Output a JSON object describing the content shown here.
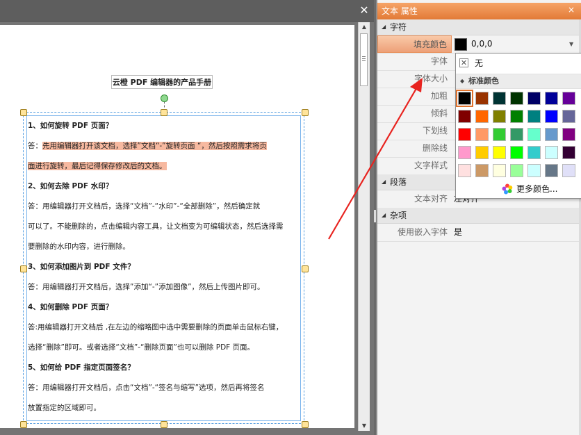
{
  "document": {
    "close_glyph": "✕",
    "title": "云橙 PDF 编辑器的产品手册",
    "lines": [
      {
        "text": "1、如何旋转  PDF  页面？",
        "bold": true,
        "highlight": false
      },
      {
        "text": "答：先用编辑器打开该文档，选择”文档“-”旋转页面 “，然后按照需求将页",
        "bold": false,
        "highlight": true,
        "hl_from": 2
      },
      {
        "text": "面进行旋转，最后记得保存修改后的文档。",
        "bold": false,
        "highlight": true,
        "hl_from": 0
      },
      {
        "text": "2、如何去除  PDF  水印？",
        "bold": true,
        "highlight": false
      },
      {
        "text": "答：用编辑器打开文档后，选择“文档”-“水印”-“全部删除”，然后确定就",
        "bold": false,
        "highlight": false
      },
      {
        "text": "可以了。不能删除的，点击编辑内容工具，让文档变为可编辑状态，然后选择需",
        "bold": false,
        "highlight": false
      },
      {
        "text": "要删除的水印内容，进行删除。",
        "bold": false,
        "highlight": false
      },
      {
        "text": "3、如何添加图片到  PDF  文件？",
        "bold": true,
        "highlight": false
      },
      {
        "text": "答：用编辑器打开文档后，选择”添加“-”添加图像”，然后上传图片即可。",
        "bold": false,
        "highlight": false
      },
      {
        "text": "4、如何删除  PDF  页面？",
        "bold": true,
        "highlight": false
      },
      {
        "text": "答:用编辑器打开文档后 ,在左边的缩略图中选中需要删除的页面单击鼠标右键，",
        "bold": false,
        "highlight": false
      },
      {
        "text": "选择“删除”即可。或者选择“文档”-“删除页面”也可以删除 PDF 页面。",
        "bold": false,
        "highlight": false
      },
      {
        "text": "5、如何给  PDF  指定页面签名？",
        "bold": true,
        "highlight": false
      },
      {
        "text": "答：用编辑器打开文档后，点击“文档”-“签名与缩写”选项，然后再将签名",
        "bold": false,
        "highlight": false
      },
      {
        "text": "放置指定的区域即可。",
        "bold": false,
        "highlight": false
      }
    ]
  },
  "properties_panel": {
    "title": "文本 属性",
    "close_glyph": "×",
    "categories": {
      "character": "字符",
      "paragraph": "段落",
      "misc": "杂项"
    },
    "rows": {
      "fill_color": {
        "name": "填充颜色",
        "value": "0,0,0"
      },
      "font": {
        "name": "字体",
        "value": ""
      },
      "font_size": {
        "name": "字体大小",
        "value": ""
      },
      "bold": {
        "name": "加粗",
        "value": ""
      },
      "italic": {
        "name": "倾斜",
        "value": ""
      },
      "underline": {
        "name": "下划线",
        "value": ""
      },
      "strikethrough": {
        "name": "删除线",
        "value": ""
      },
      "text_style": {
        "name": "文字样式",
        "value": ""
      },
      "text_align": {
        "name": "文本对齐",
        "value": "左对齐"
      },
      "embed_font": {
        "name": "使用嵌入字体",
        "value": "是"
      }
    }
  },
  "color_popup": {
    "none_label": "无",
    "none_glyph": "✕",
    "standard_colors_label": "标准颜色",
    "more_colors_label": "更多颜色...",
    "selected_index": 0,
    "palette": [
      [
        "#000000",
        "#993300",
        "#003333",
        "#003300",
        "#000066",
        "#000099",
        "#660099"
      ],
      [
        "#800000",
        "#ff6600",
        "#808000",
        "#008000",
        "#008080",
        "#0000ff",
        "#666699"
      ],
      [
        "#ff0000",
        "#ff9966",
        "#33cc33",
        "#339966",
        "#66ffcc",
        "#6699cc",
        "#800080"
      ],
      [
        "#ff99cc",
        "#ffcc00",
        "#ffff00",
        "#00ff00",
        "#33cccc",
        "#ccffff",
        "#330033"
      ],
      [
        "#ffe0e0",
        "#cc9966",
        "#ffffe0",
        "#99ff99",
        "#ccffff",
        "#667788",
        "#e0e0f8"
      ]
    ]
  },
  "colors": {
    "header_orange": "#e27a36",
    "selected_row": "#f2b088",
    "highlight": "#f7b9a0",
    "annotation_arrow": "#e8231f"
  }
}
